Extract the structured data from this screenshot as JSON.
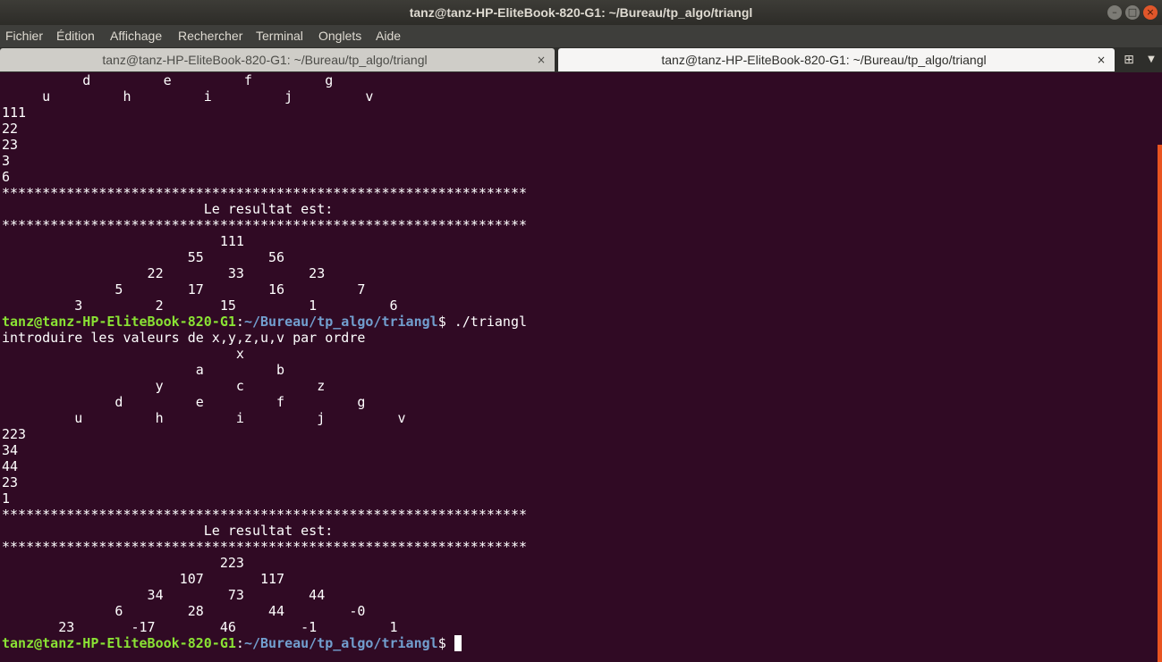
{
  "window": {
    "title": "tanz@tanz-HP-EliteBook-820-G1: ~/Bureau/tp_algo/triangl",
    "buttons": {
      "minimize": "–",
      "maximize": "□",
      "close": "×"
    }
  },
  "menu": {
    "items": [
      "Fichier",
      "Édition",
      "Affichage",
      "Rechercher",
      "Terminal",
      "Onglets",
      "Aide"
    ]
  },
  "tabs": [
    {
      "label": "tanz@tanz-HP-EliteBook-820-G1: ~/Bureau/tp_algo/triangl",
      "close": "×",
      "active": false
    },
    {
      "label": "tanz@tanz-HP-EliteBook-820-G1: ~/Bureau/tp_algo/triangl",
      "close": "×",
      "active": true
    }
  ],
  "tabbar": {
    "new_tab_icon": "⊞",
    "menu_icon": "▼"
  },
  "prompt": {
    "user_host": "tanz@tanz-HP-EliteBook-820-G1",
    "colon": ":",
    "path": "~/Bureau/tp_algo/triangl",
    "symbol": "$ "
  },
  "lines": [
    {
      "text": "          d         e         f         g"
    },
    {
      "text": "     u         h         i         j         v"
    },
    {
      "text": "111"
    },
    {
      "text": "22"
    },
    {
      "text": "23"
    },
    {
      "text": "3"
    },
    {
      "text": "6"
    },
    {
      "text": "*****************************************************************"
    },
    {
      "text": "                         Le resultat est:"
    },
    {
      "text": "*****************************************************************"
    },
    {
      "text": "                           111"
    },
    {
      "text": "                       55        56"
    },
    {
      "text": "                  22        33        23"
    },
    {
      "text": "              5        17        16         7"
    },
    {
      "text": "         3         2       15         1         6"
    },
    {
      "prompt": true,
      "cmd": "./triangl"
    },
    {
      "text": "introduire les valeurs de x,y,z,u,v par ordre"
    },
    {
      "text": "                             x"
    },
    {
      "text": "                        a         b"
    },
    {
      "text": "                   y         c         z"
    },
    {
      "text": "              d         e         f         g"
    },
    {
      "text": "         u         h         i         j         v"
    },
    {
      "text": "223"
    },
    {
      "text": "34"
    },
    {
      "text": "44"
    },
    {
      "text": "23"
    },
    {
      "text": "1"
    },
    {
      "text": "*****************************************************************"
    },
    {
      "text": "                         Le resultat est:"
    },
    {
      "text": "*****************************************************************"
    },
    {
      "text": "                           223"
    },
    {
      "text": "                      107       117"
    },
    {
      "text": "                  34        73        44"
    },
    {
      "text": "              6        28        44        -0"
    },
    {
      "text": "       23       -17        46        -1         1"
    },
    {
      "prompt": true,
      "cmd": "",
      "cursor": true
    }
  ]
}
